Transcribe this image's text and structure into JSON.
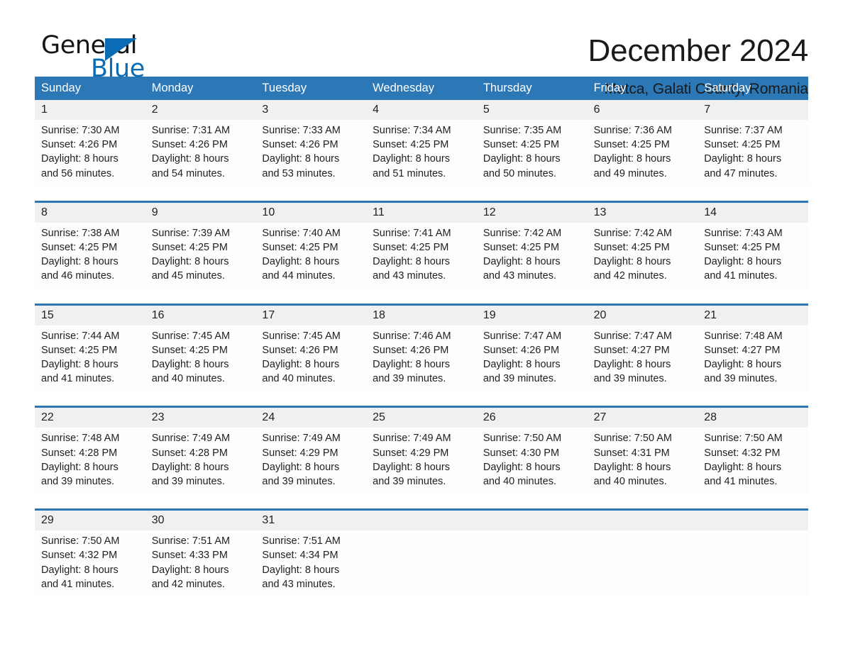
{
  "brand": {
    "name_part1": "General",
    "name_part2": "Blue",
    "triangle_color": "#0a6cb4"
  },
  "header": {
    "month_title": "December 2024",
    "location": "Matca, Galati County, Romania"
  },
  "theme": {
    "header_blue": "#2c77b5",
    "daynum_band": "#f0f0f0",
    "week_separator": "#2c77b5",
    "text": "#1f1f1f"
  },
  "calendar": {
    "weekdays": [
      "Sunday",
      "Monday",
      "Tuesday",
      "Wednesday",
      "Thursday",
      "Friday",
      "Saturday"
    ],
    "weeks": [
      {
        "days": [
          {
            "num": "1",
            "sunrise": "Sunrise: 7:30 AM",
            "sunset": "Sunset: 4:26 PM",
            "daylight1": "Daylight: 8 hours",
            "daylight2": "and 56 minutes."
          },
          {
            "num": "2",
            "sunrise": "Sunrise: 7:31 AM",
            "sunset": "Sunset: 4:26 PM",
            "daylight1": "Daylight: 8 hours",
            "daylight2": "and 54 minutes."
          },
          {
            "num": "3",
            "sunrise": "Sunrise: 7:33 AM",
            "sunset": "Sunset: 4:26 PM",
            "daylight1": "Daylight: 8 hours",
            "daylight2": "and 53 minutes."
          },
          {
            "num": "4",
            "sunrise": "Sunrise: 7:34 AM",
            "sunset": "Sunset: 4:25 PM",
            "daylight1": "Daylight: 8 hours",
            "daylight2": "and 51 minutes."
          },
          {
            "num": "5",
            "sunrise": "Sunrise: 7:35 AM",
            "sunset": "Sunset: 4:25 PM",
            "daylight1": "Daylight: 8 hours",
            "daylight2": "and 50 minutes."
          },
          {
            "num": "6",
            "sunrise": "Sunrise: 7:36 AM",
            "sunset": "Sunset: 4:25 PM",
            "daylight1": "Daylight: 8 hours",
            "daylight2": "and 49 minutes."
          },
          {
            "num": "7",
            "sunrise": "Sunrise: 7:37 AM",
            "sunset": "Sunset: 4:25 PM",
            "daylight1": "Daylight: 8 hours",
            "daylight2": "and 47 minutes."
          }
        ]
      },
      {
        "days": [
          {
            "num": "8",
            "sunrise": "Sunrise: 7:38 AM",
            "sunset": "Sunset: 4:25 PM",
            "daylight1": "Daylight: 8 hours",
            "daylight2": "and 46 minutes."
          },
          {
            "num": "9",
            "sunrise": "Sunrise: 7:39 AM",
            "sunset": "Sunset: 4:25 PM",
            "daylight1": "Daylight: 8 hours",
            "daylight2": "and 45 minutes."
          },
          {
            "num": "10",
            "sunrise": "Sunrise: 7:40 AM",
            "sunset": "Sunset: 4:25 PM",
            "daylight1": "Daylight: 8 hours",
            "daylight2": "and 44 minutes."
          },
          {
            "num": "11",
            "sunrise": "Sunrise: 7:41 AM",
            "sunset": "Sunset: 4:25 PM",
            "daylight1": "Daylight: 8 hours",
            "daylight2": "and 43 minutes."
          },
          {
            "num": "12",
            "sunrise": "Sunrise: 7:42 AM",
            "sunset": "Sunset: 4:25 PM",
            "daylight1": "Daylight: 8 hours",
            "daylight2": "and 43 minutes."
          },
          {
            "num": "13",
            "sunrise": "Sunrise: 7:42 AM",
            "sunset": "Sunset: 4:25 PM",
            "daylight1": "Daylight: 8 hours",
            "daylight2": "and 42 minutes."
          },
          {
            "num": "14",
            "sunrise": "Sunrise: 7:43 AM",
            "sunset": "Sunset: 4:25 PM",
            "daylight1": "Daylight: 8 hours",
            "daylight2": "and 41 minutes."
          }
        ]
      },
      {
        "days": [
          {
            "num": "15",
            "sunrise": "Sunrise: 7:44 AM",
            "sunset": "Sunset: 4:25 PM",
            "daylight1": "Daylight: 8 hours",
            "daylight2": "and 41 minutes."
          },
          {
            "num": "16",
            "sunrise": "Sunrise: 7:45 AM",
            "sunset": "Sunset: 4:25 PM",
            "daylight1": "Daylight: 8 hours",
            "daylight2": "and 40 minutes."
          },
          {
            "num": "17",
            "sunrise": "Sunrise: 7:45 AM",
            "sunset": "Sunset: 4:26 PM",
            "daylight1": "Daylight: 8 hours",
            "daylight2": "and 40 minutes."
          },
          {
            "num": "18",
            "sunrise": "Sunrise: 7:46 AM",
            "sunset": "Sunset: 4:26 PM",
            "daylight1": "Daylight: 8 hours",
            "daylight2": "and 39 minutes."
          },
          {
            "num": "19",
            "sunrise": "Sunrise: 7:47 AM",
            "sunset": "Sunset: 4:26 PM",
            "daylight1": "Daylight: 8 hours",
            "daylight2": "and 39 minutes."
          },
          {
            "num": "20",
            "sunrise": "Sunrise: 7:47 AM",
            "sunset": "Sunset: 4:27 PM",
            "daylight1": "Daylight: 8 hours",
            "daylight2": "and 39 minutes."
          },
          {
            "num": "21",
            "sunrise": "Sunrise: 7:48 AM",
            "sunset": "Sunset: 4:27 PM",
            "daylight1": "Daylight: 8 hours",
            "daylight2": "and 39 minutes."
          }
        ]
      },
      {
        "days": [
          {
            "num": "22",
            "sunrise": "Sunrise: 7:48 AM",
            "sunset": "Sunset: 4:28 PM",
            "daylight1": "Daylight: 8 hours",
            "daylight2": "and 39 minutes."
          },
          {
            "num": "23",
            "sunrise": "Sunrise: 7:49 AM",
            "sunset": "Sunset: 4:28 PM",
            "daylight1": "Daylight: 8 hours",
            "daylight2": "and 39 minutes."
          },
          {
            "num": "24",
            "sunrise": "Sunrise: 7:49 AM",
            "sunset": "Sunset: 4:29 PM",
            "daylight1": "Daylight: 8 hours",
            "daylight2": "and 39 minutes."
          },
          {
            "num": "25",
            "sunrise": "Sunrise: 7:49 AM",
            "sunset": "Sunset: 4:29 PM",
            "daylight1": "Daylight: 8 hours",
            "daylight2": "and 39 minutes."
          },
          {
            "num": "26",
            "sunrise": "Sunrise: 7:50 AM",
            "sunset": "Sunset: 4:30 PM",
            "daylight1": "Daylight: 8 hours",
            "daylight2": "and 40 minutes."
          },
          {
            "num": "27",
            "sunrise": "Sunrise: 7:50 AM",
            "sunset": "Sunset: 4:31 PM",
            "daylight1": "Daylight: 8 hours",
            "daylight2": "and 40 minutes."
          },
          {
            "num": "28",
            "sunrise": "Sunrise: 7:50 AM",
            "sunset": "Sunset: 4:32 PM",
            "daylight1": "Daylight: 8 hours",
            "daylight2": "and 41 minutes."
          }
        ]
      },
      {
        "days": [
          {
            "num": "29",
            "sunrise": "Sunrise: 7:50 AM",
            "sunset": "Sunset: 4:32 PM",
            "daylight1": "Daylight: 8 hours",
            "daylight2": "and 41 minutes."
          },
          {
            "num": "30",
            "sunrise": "Sunrise: 7:51 AM",
            "sunset": "Sunset: 4:33 PM",
            "daylight1": "Daylight: 8 hours",
            "daylight2": "and 42 minutes."
          },
          {
            "num": "31",
            "sunrise": "Sunrise: 7:51 AM",
            "sunset": "Sunset: 4:34 PM",
            "daylight1": "Daylight: 8 hours",
            "daylight2": "and 43 minutes."
          },
          {
            "num": "",
            "sunrise": "",
            "sunset": "",
            "daylight1": "",
            "daylight2": ""
          },
          {
            "num": "",
            "sunrise": "",
            "sunset": "",
            "daylight1": "",
            "daylight2": ""
          },
          {
            "num": "",
            "sunrise": "",
            "sunset": "",
            "daylight1": "",
            "daylight2": ""
          },
          {
            "num": "",
            "sunrise": "",
            "sunset": "",
            "daylight1": "",
            "daylight2": ""
          }
        ]
      }
    ]
  }
}
